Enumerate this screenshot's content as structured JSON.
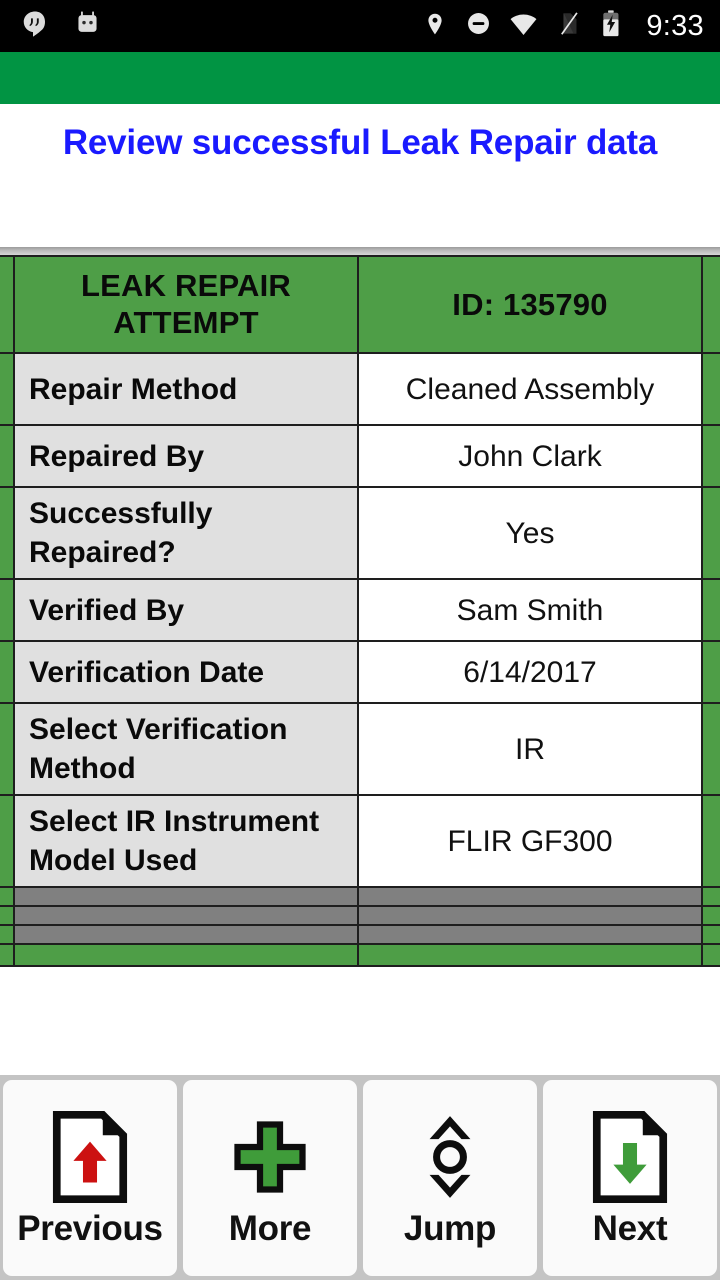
{
  "status_bar": {
    "left_icons": [
      "hangouts-icon",
      "android-head-icon"
    ],
    "right_icons": [
      "location-pin-icon",
      "do-not-disturb-icon",
      "wifi-icon",
      "sim-off-icon",
      "battery-charging-icon"
    ],
    "time": "9:33"
  },
  "app_bar": {
    "color": "#019443"
  },
  "header": {
    "title": "Review successful Leak Repair data",
    "title_color": "#1a1aff"
  },
  "table": {
    "header": {
      "label": "LEAK REPAIR ATTEMPT",
      "value": "ID: 135790"
    },
    "rows": [
      {
        "label": "Repair Method",
        "value": "Cleaned Assembly"
      },
      {
        "label": "Repaired By",
        "value": "John Clark"
      },
      {
        "label": "Successfully Repaired?",
        "value": "Yes"
      },
      {
        "label": "Verified By",
        "value": "Sam Smith"
      },
      {
        "label": "Verification Date",
        "value": "6/14/2017"
      },
      {
        "label": "Select Verification Method",
        "value": "IR"
      },
      {
        "label": "Select IR Instrument Model Used",
        "value": "FLIR GF300"
      }
    ],
    "empty_rows": 3,
    "colors": {
      "header_green": "#4e9e47",
      "label_gray": "#e0e0e0",
      "value_white": "#ffffff",
      "empty_gray": "#808080"
    }
  },
  "nav": {
    "buttons": [
      {
        "label": "Previous",
        "icon": "document-up-arrow-icon",
        "accent": "#cc1111"
      },
      {
        "label": "More",
        "icon": "plus-icon",
        "accent": "#3f9c3a"
      },
      {
        "label": "Jump",
        "icon": "jump-updown-icon",
        "accent": "#111111"
      },
      {
        "label": "Next",
        "icon": "document-down-arrow-icon",
        "accent": "#3f9c3a"
      }
    ]
  }
}
